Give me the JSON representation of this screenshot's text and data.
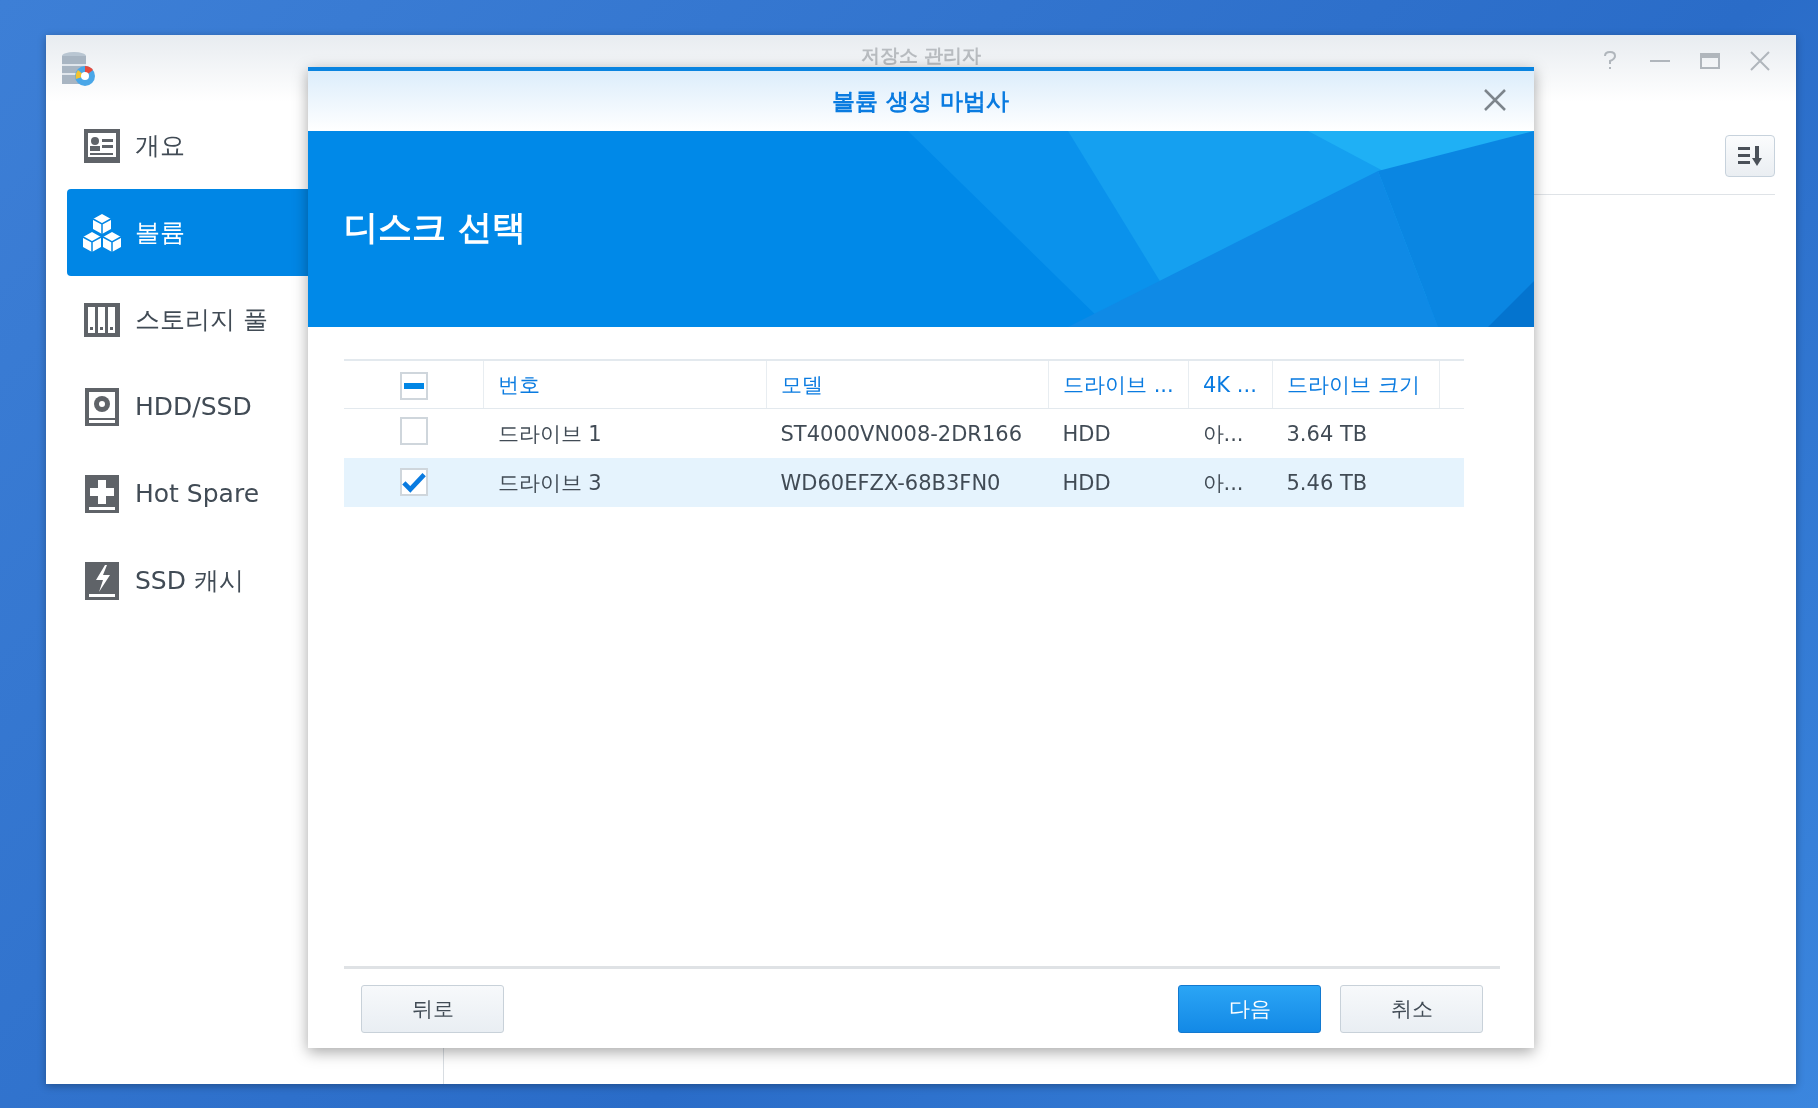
{
  "window": {
    "title": "저장소 관리자"
  },
  "sidebar": {
    "items": [
      {
        "label": "개요",
        "kind": "overview",
        "selected": false
      },
      {
        "label": "볼륨",
        "kind": "volume",
        "selected": true
      },
      {
        "label": "스토리지 풀",
        "kind": "pool",
        "selected": false
      },
      {
        "label": "HDD/SSD",
        "kind": "disk",
        "selected": false
      },
      {
        "label": "Hot Spare",
        "kind": "spare",
        "selected": false
      },
      {
        "label": "SSD 캐시",
        "kind": "cache",
        "selected": false
      }
    ]
  },
  "dialog": {
    "title": "볼륨 생성 마법사",
    "heading": "디스크 선택",
    "table": {
      "select_all": {
        "indeterminate": true
      },
      "columns": [
        "번호",
        "모델",
        "드라이브 ...",
        "4K ...",
        "드라이브 크기"
      ],
      "rows": [
        {
          "checked": false,
          "selected": false,
          "cells": [
            "드라이브 1",
            "ST4000VN008-2DR166",
            "HDD",
            "아...",
            "3.64 TB"
          ]
        },
        {
          "checked": true,
          "selected": true,
          "cells": [
            "드라이브 3",
            "WD60EFZX-68B3FN0",
            "HDD",
            "아...",
            "5.46 TB"
          ]
        }
      ]
    },
    "buttons_left": [
      {
        "label": "뒤로",
        "kind": "secondary"
      }
    ],
    "buttons_right": [
      {
        "label": "다음",
        "kind": "primary"
      },
      {
        "label": "취소",
        "kind": "secondary"
      }
    ]
  }
}
